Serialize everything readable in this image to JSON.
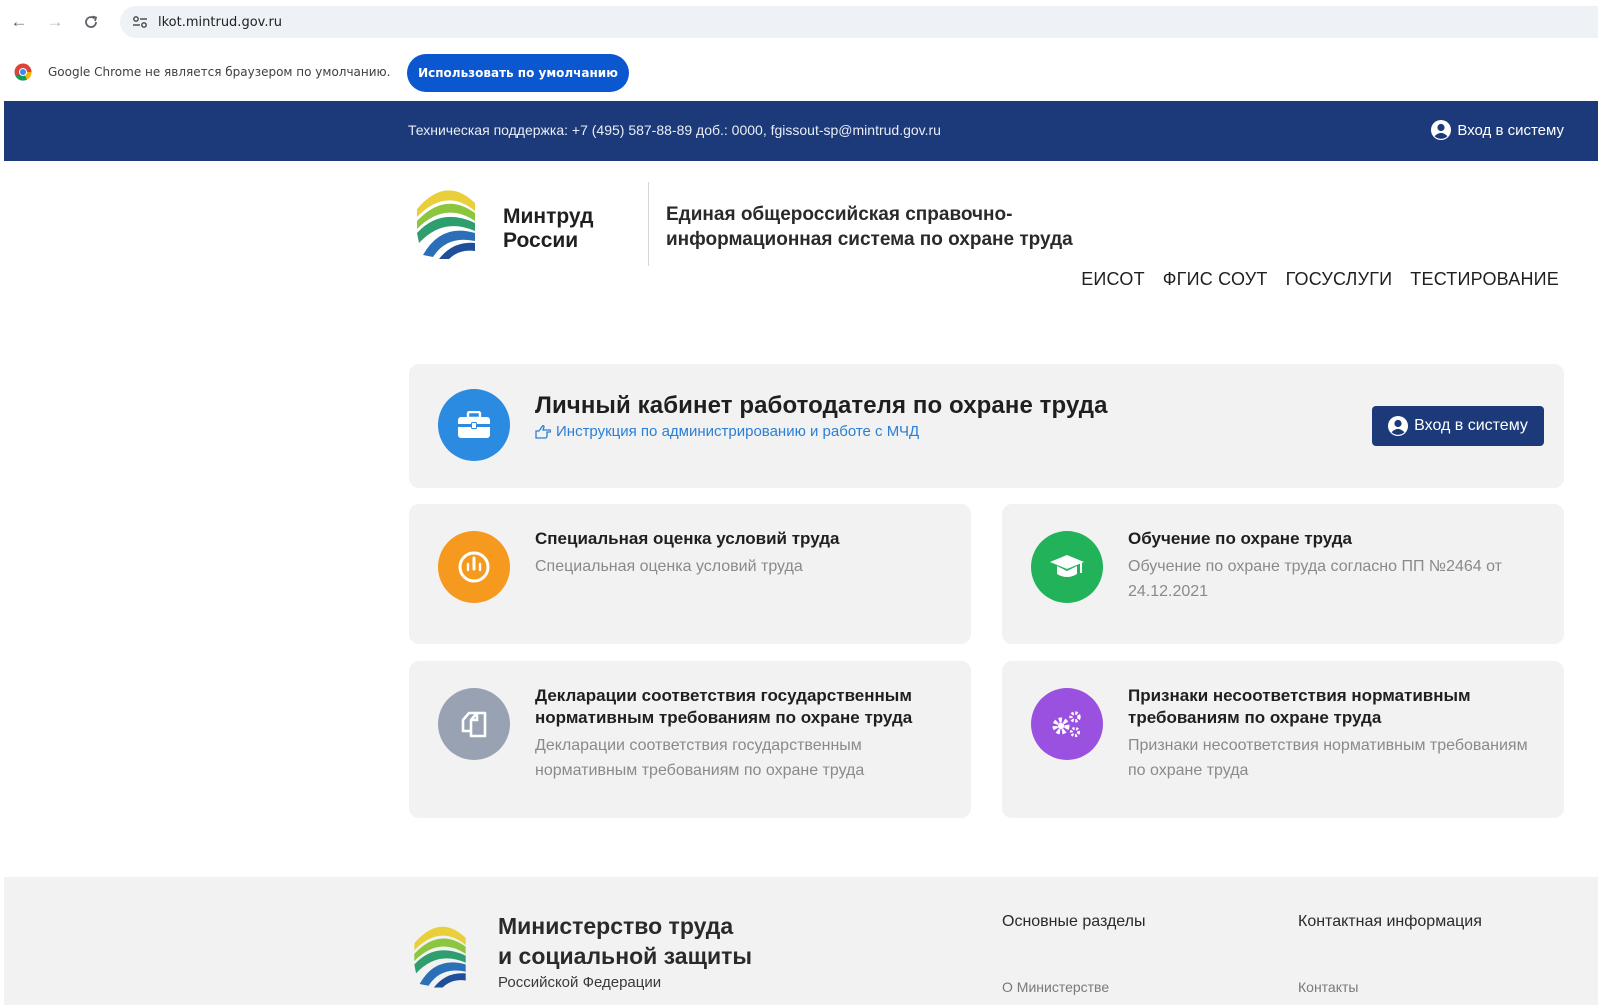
{
  "browser": {
    "url": "lkot.mintrud.gov.ru",
    "infobar_text": "Google Chrome не является браузером по умолчанию.",
    "infobar_button": "Использовать по умолчанию"
  },
  "topbar": {
    "support_text": "Техническая поддержка: +7 (495) 587-88-89 доб.: 0000, fgissout-sp@mintrud.gov.ru",
    "login_label": "Вход в систему"
  },
  "header": {
    "brand_line1": "Минтруд",
    "brand_line2": "России",
    "system_line1": "Единая общероссийская справочно-",
    "system_line2": "информационная система по охране труда",
    "nav": [
      "ЕИСОТ",
      "ФГИС СОУТ",
      "ГОСУСЛУГИ",
      "ТЕСТИРОВАНИЕ"
    ]
  },
  "hero": {
    "title": "Личный кабинет работодателя по охране труда",
    "link": "Инструкция по администрированию и работе с МЧД",
    "button": "Вход в систему"
  },
  "services": [
    {
      "title": "Специальная оценка условий труда",
      "description": "Специальная оценка условий труда",
      "icon": "gauge-icon",
      "color": "#f59a1e"
    },
    {
      "title": "Обучение по охране труда",
      "description": "Обучение по охране труда согласно ПП №2464 от 24.12.2021",
      "icon": "graduation-cap-icon",
      "color": "#22b25a"
    },
    {
      "title": "Декларации соответствия государственным нормативным требованиям по охране труда",
      "description": "Декларации соответствия государственным нормативным требованиям по охране труда",
      "icon": "copy-icon",
      "color": "#98a2b3"
    },
    {
      "title": "Признаки несоответствия нормативным требованиям по охране труда",
      "description": "Признаки несоответствия нормативным требованиям по охране труда",
      "icon": "gears-icon",
      "color": "#9b51e0"
    }
  ],
  "footer": {
    "title_line1": "Министерство труда",
    "title_line2": "и социальной защиты",
    "subtitle": "Российской Федерации",
    "col1_heading": "Основные разделы",
    "col1_link": "О Министерстве",
    "col2_heading": "Контактная информация",
    "col2_link": "Контакты"
  },
  "colors": {
    "topbar": "#1c3a7a",
    "accent_blue": "#2a8be0",
    "link": "#2a7fd6",
    "card_bg": "#f2f2f2"
  }
}
